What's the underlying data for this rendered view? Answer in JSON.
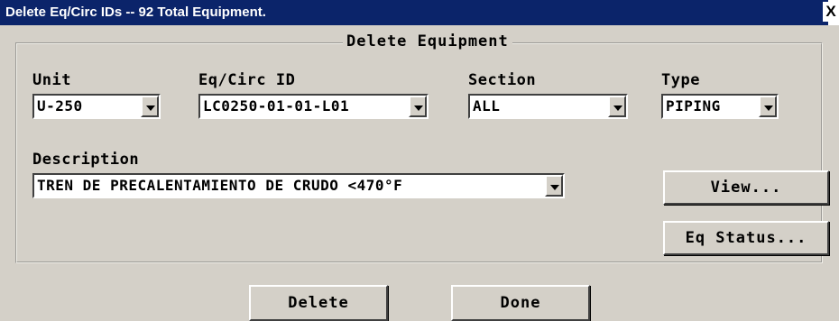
{
  "window": {
    "title": "Delete Eq/Circ IDs -- 92 Total Equipment.",
    "close_label": "X"
  },
  "group": {
    "title": "Delete Equipment"
  },
  "fields": {
    "unit": {
      "label": "Unit",
      "value": "U-250"
    },
    "eq_circ_id": {
      "label": "Eq/Circ ID",
      "value": "LC0250-01-01-L01"
    },
    "section": {
      "label": "Section",
      "value": "ALL"
    },
    "type": {
      "label": "Type",
      "value": "PIPING"
    },
    "description": {
      "label": "Description",
      "value": "TREN DE PRECALENTAMIENTO DE CRUDO <470°F"
    }
  },
  "buttons": {
    "view": "View...",
    "eq_status": "Eq Status...",
    "delete": "Delete",
    "done": "Done"
  },
  "colors": {
    "titlebar": "#0b246a",
    "face": "#d4d0c8"
  }
}
